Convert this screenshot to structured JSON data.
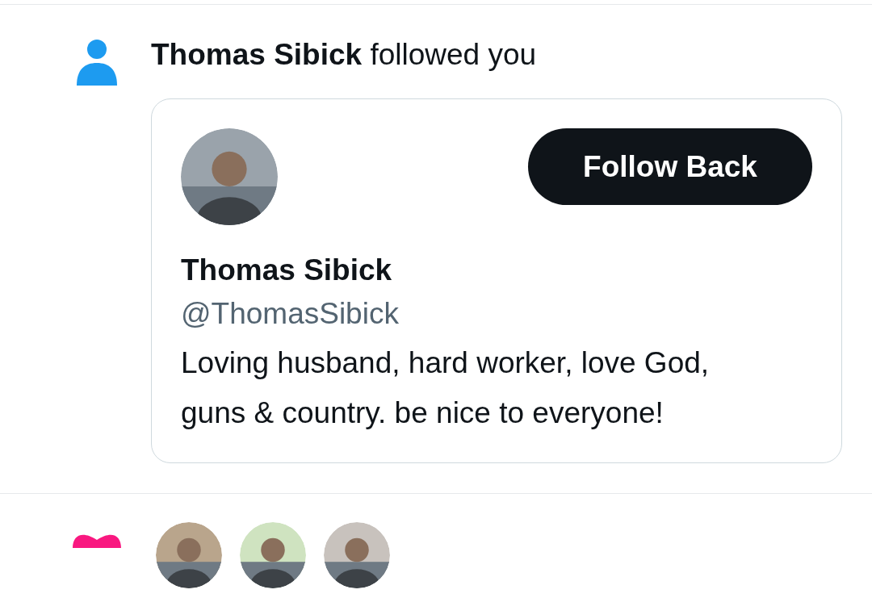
{
  "notifications": [
    {
      "kind": "follow",
      "actor": "Thomas Sibick",
      "action": "followed you",
      "card": {
        "button": "Follow Back",
        "name": "Thomas Sibick",
        "handle": "@ThomasSibick",
        "bio": "Loving husband, hard worker, love God, guns & country. be nice to everyone!"
      }
    },
    {
      "kind": "like"
    }
  ]
}
